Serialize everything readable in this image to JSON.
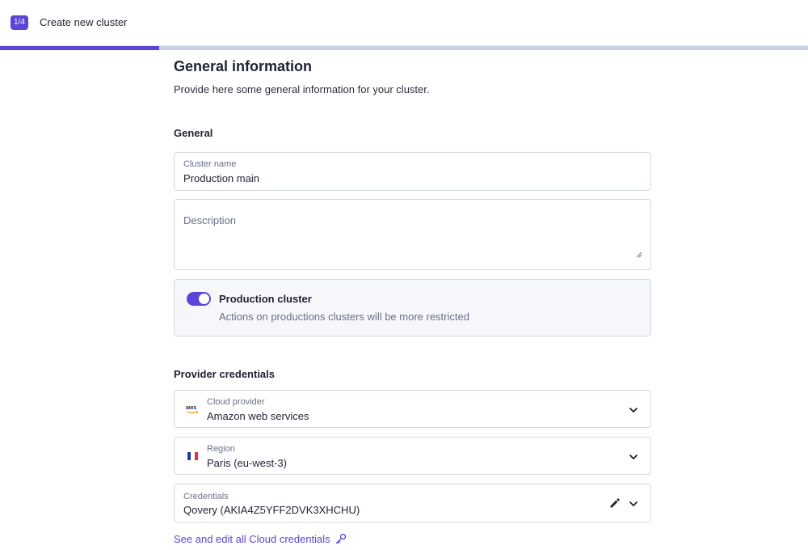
{
  "header": {
    "step": "1/4",
    "title": "Create new cluster",
    "progress_fraction": 0.197
  },
  "page": {
    "title": "General information",
    "subtitle": "Provide here some general information for your cluster."
  },
  "general": {
    "section_title": "General",
    "cluster_name": {
      "label": "Cluster name",
      "value": "Production main"
    },
    "description": {
      "placeholder": "Description",
      "value": ""
    },
    "production": {
      "title": "Production cluster",
      "description": "Actions on productions clusters will be more restricted",
      "enabled": true
    }
  },
  "provider": {
    "section_title": "Provider credentials",
    "cloud_provider": {
      "label": "Cloud provider",
      "value": "Amazon web services",
      "icon": "aws-icon"
    },
    "region": {
      "label": "Region",
      "value": "Paris (eu-west-3)",
      "icon": "france-flag-icon"
    },
    "credentials": {
      "label": "Credentials",
      "value": "Qovery (AKIA4Z5YFF2DVK3XHCHU)"
    },
    "link_label": "See and edit all Cloud credentials"
  },
  "colors": {
    "accent": "#5b45d6",
    "progress_track": "#c9d2e6",
    "border": "#d3d8e3",
    "muted_text": "#6a7086"
  }
}
